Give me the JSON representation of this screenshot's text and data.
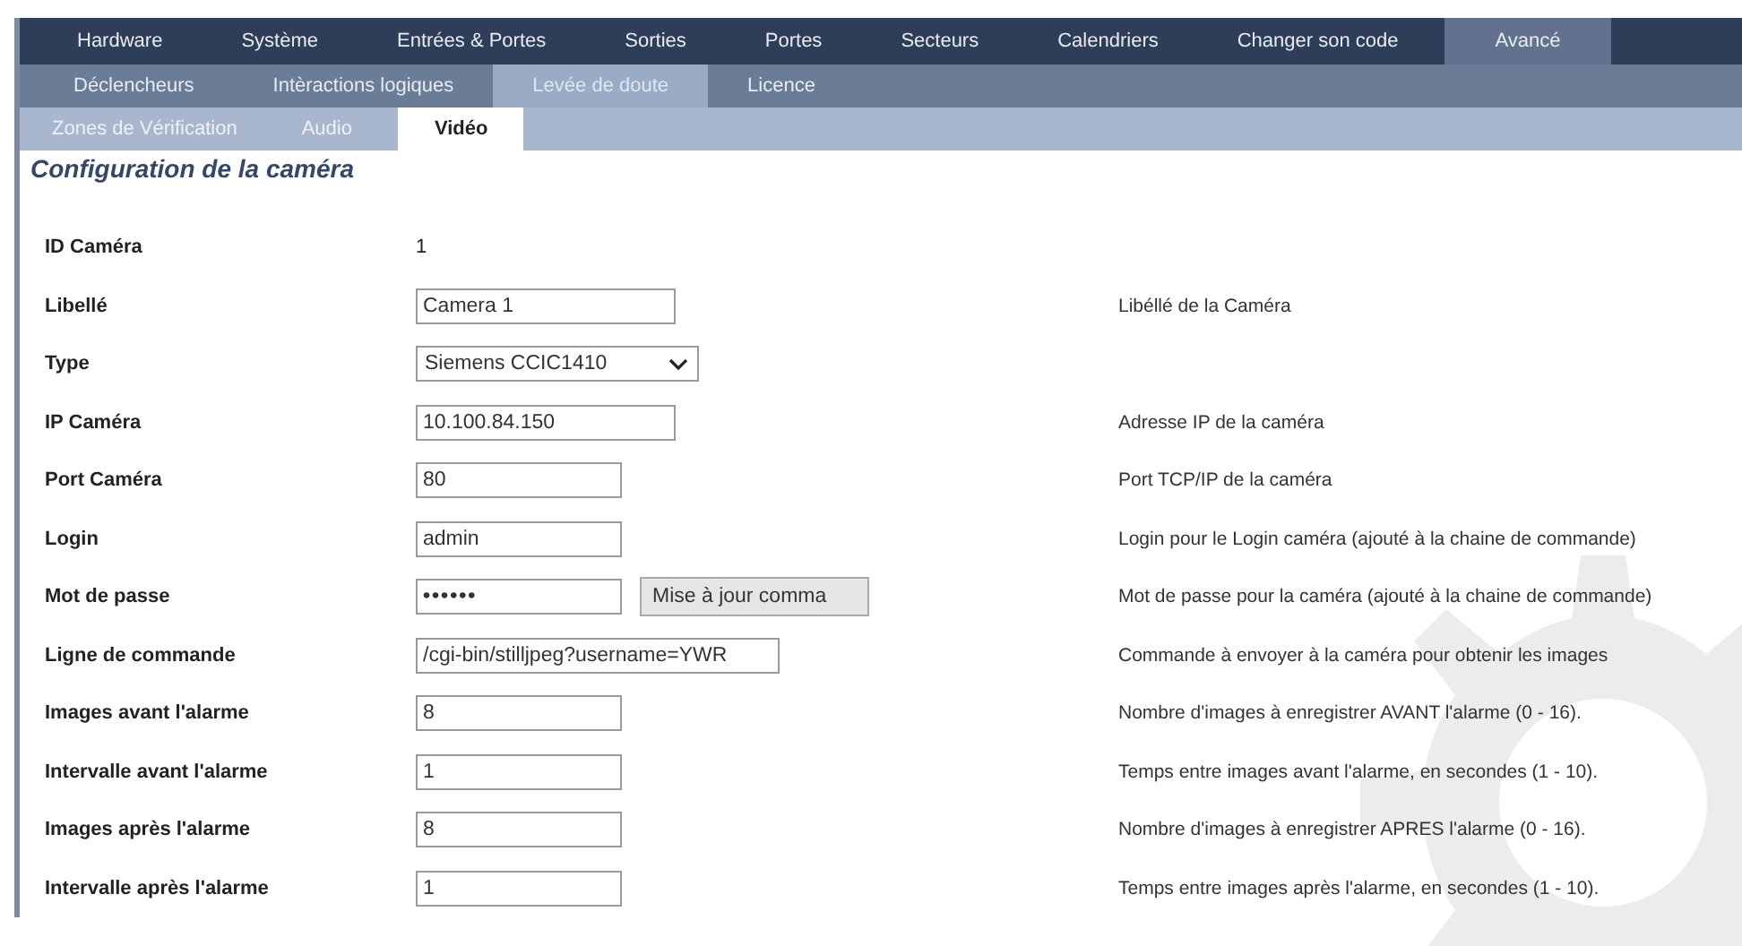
{
  "tabs": [
    {
      "label": "Hardware",
      "selected": false
    },
    {
      "label": "Système",
      "selected": false
    },
    {
      "label": "Entrées & Portes",
      "selected": false
    },
    {
      "label": "Sorties",
      "selected": false
    },
    {
      "label": "Portes",
      "selected": false
    },
    {
      "label": "Secteurs",
      "selected": false
    },
    {
      "label": "Calendriers",
      "selected": false
    },
    {
      "label": "Changer son code",
      "selected": false
    },
    {
      "label": "Avancé",
      "selected": true
    }
  ],
  "subtabs": [
    {
      "label": "Déclencheurs",
      "selected": false
    },
    {
      "label": "Intèractions logiques",
      "selected": false
    },
    {
      "label": "Levée de doute",
      "selected": true
    },
    {
      "label": "Licence",
      "selected": false
    }
  ],
  "subsubtabs": [
    {
      "label": "Zones de Vérification",
      "selected": false
    },
    {
      "label": "Audio",
      "selected": false
    },
    {
      "label": "Vidéo",
      "selected": true
    }
  ],
  "section_title": "Configuration de la caméra",
  "rows": [
    {
      "kind": "text",
      "label": "ID Caméra",
      "value": "1"
    },
    {
      "kind": "wide",
      "label": "Libellé",
      "value": "Camera 1",
      "description": "Libéllé de la Caméra"
    },
    {
      "kind": "select",
      "label": "Type",
      "value": "Siemens CCIC1410"
    },
    {
      "kind": "wide",
      "label": "IP Caméra",
      "value": "10.100.84.150",
      "description": "Adresse IP de la caméra"
    },
    {
      "kind": "short",
      "label": "Port Caméra",
      "value": "80",
      "description": "Port TCP/IP de la caméra"
    },
    {
      "kind": "short",
      "label": "Login",
      "value": "admin",
      "description": "Login pour le Login caméra (ajouté à la chaine de commande)"
    },
    {
      "kind": "password",
      "label": "Mot de passe",
      "value": "••••••",
      "button": "Mise à jour comma",
      "description": "Mot de passe pour la caméra (ajouté à la chaine de commande)"
    },
    {
      "kind": "long",
      "label": "Ligne de commande",
      "value": "/cgi-bin/stilljpeg?username=YWR",
      "description": "Commande à envoyer à la caméra pour obtenir les images"
    },
    {
      "kind": "short",
      "label": "Images avant l'alarme",
      "value": "8",
      "description": "Nombre d'images à enregistrer AVANT l'alarme (0 - 16)."
    },
    {
      "kind": "short",
      "label": "Intervalle avant l'alarme",
      "value": "1",
      "description": "Temps entre images avant l'alarme, en secondes (1 - 10)."
    },
    {
      "kind": "short",
      "label": "Images après l'alarme",
      "value": "8",
      "description": "Nombre d'images à enregistrer APRES l'alarme (0 - 16)."
    },
    {
      "kind": "short",
      "label": "Intervalle après l'alarme",
      "value": "1",
      "description": "Temps entre images après l'alarme, en secondes (1 - 10)."
    }
  ]
}
